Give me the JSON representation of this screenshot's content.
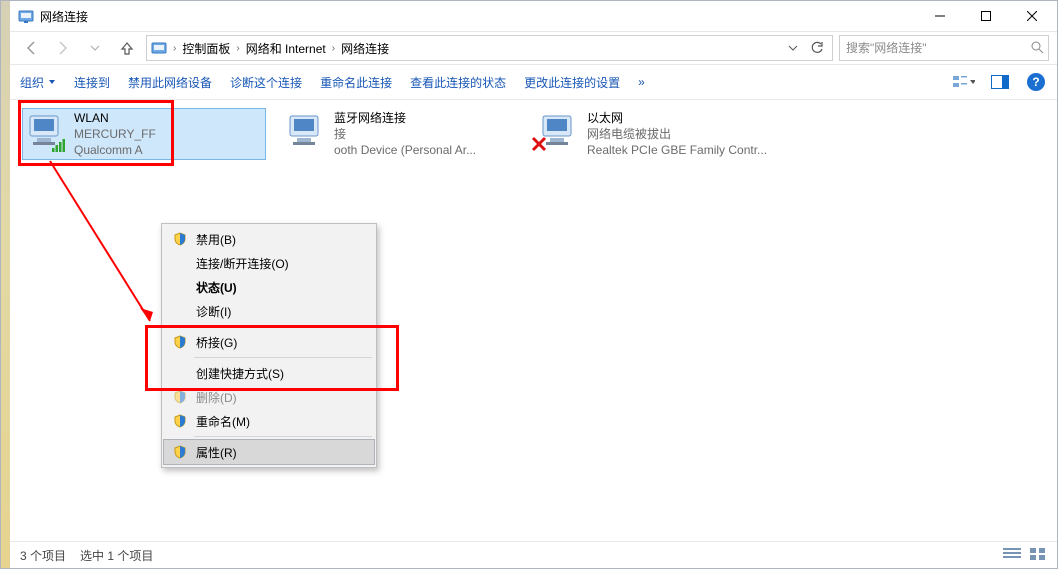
{
  "title": "网络连接",
  "breadcrumb": {
    "a": "控制面板",
    "b": "网络和 Internet",
    "c": "网络连接"
  },
  "search": {
    "placeholder": "搜索\"网络连接\""
  },
  "toolbar": {
    "organize": "组织",
    "connect": "连接到",
    "disable": "禁用此网络设备",
    "diagnose": "诊断这个连接",
    "rename": "重命名此连接",
    "viewstatus": "查看此连接的状态",
    "changeset": "更改此连接的设置"
  },
  "items": {
    "wlan": {
      "name": "WLAN",
      "line2": "MERCURY_FF",
      "line3": "Qualcomm A"
    },
    "bt": {
      "name": "蓝牙网络连接",
      "line2": "接",
      "line3": "ooth Device (Personal Ar..."
    },
    "eth": {
      "name": "以太网",
      "line2": "网络电缆被拔出",
      "line3": "Realtek PCIe GBE Family Contr..."
    }
  },
  "menu": {
    "disable": "禁用(B)",
    "conn": "连接/断开连接(O)",
    "status": "状态(U)",
    "diag": "诊断(I)",
    "bridge": "桥接(G)",
    "shortcut": "创建快捷方式(S)",
    "delete": "删除(D)",
    "rename": "重命名(M)",
    "props": "属性(R)"
  },
  "status": {
    "count": "3 个项目",
    "selected": "选中 1 个项目"
  }
}
